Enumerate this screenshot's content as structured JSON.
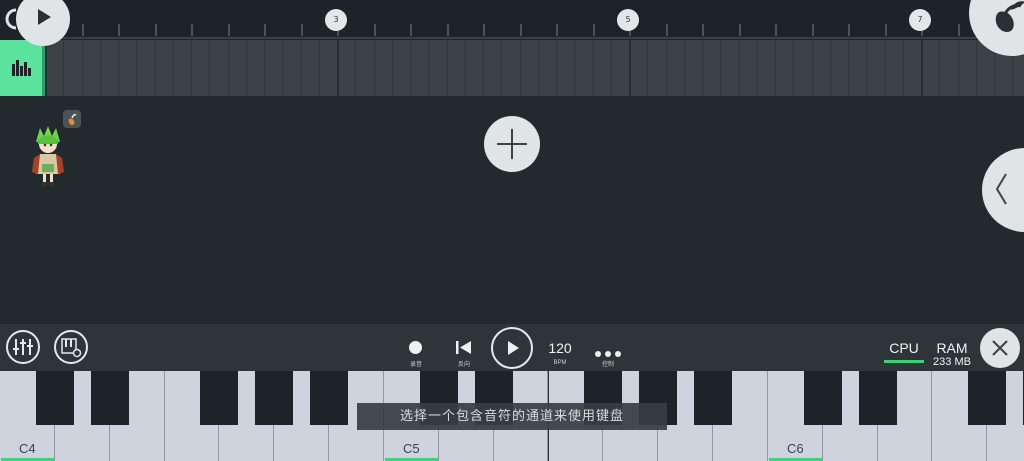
{
  "timeline": {
    "bar_markers": [
      "3",
      "5",
      "7"
    ]
  },
  "transport": {
    "record_label": "录音",
    "reverse_label": "反向",
    "tempo_value": "120",
    "tempo_unit": "BPM",
    "more_label": "控制",
    "cpu_label": "CPU",
    "ram_label": "RAM",
    "ram_value": "233 MB"
  },
  "keyboard": {
    "octave_labels": [
      "C4",
      "C5",
      "C6"
    ],
    "hint_text": "选择一个包含音符的通道来使用键盘"
  },
  "colors": {
    "accent": "#5be39d",
    "cpu_meter": "#38d36f",
    "background": "#232a2d"
  },
  "icons": [
    "play-icon",
    "channel-rack-icon",
    "plus-icon",
    "chevron-left-icon",
    "fruit-logo-icon",
    "mixer-icon",
    "piano-settings-icon",
    "record-icon",
    "skip-back-icon",
    "more-icon",
    "close-icon"
  ]
}
